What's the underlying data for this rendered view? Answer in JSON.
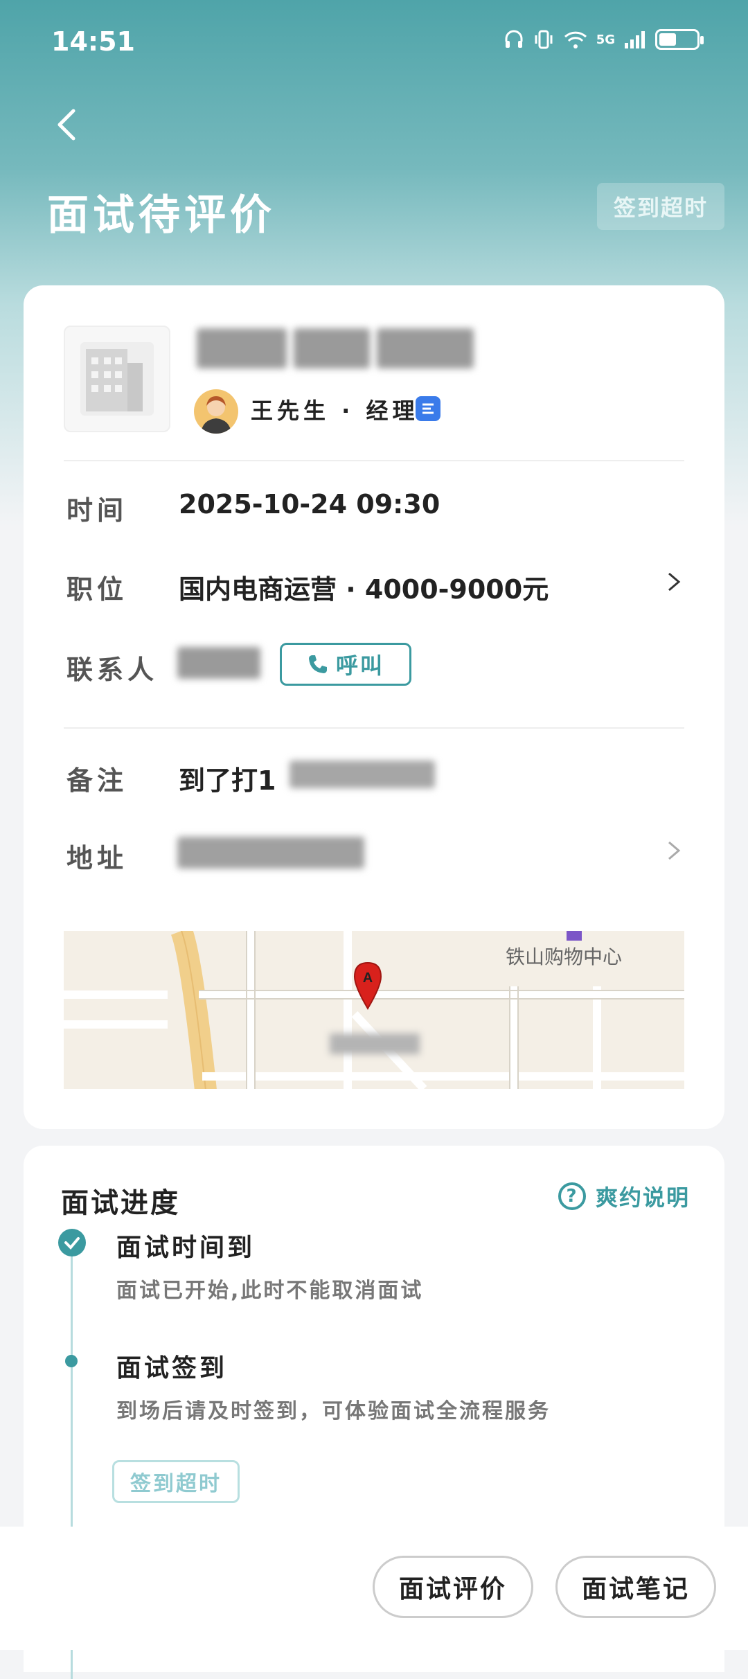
{
  "status_bar": {
    "time": "14:51",
    "network": "5G"
  },
  "header": {
    "title": "面试待评价",
    "status_badge": "签到超时"
  },
  "company": {
    "name": "",
    "contact_person": "王先生 · 经理"
  },
  "details": {
    "time_label": "时间",
    "time_value": "2025-10-24 09:30",
    "position_label": "职位",
    "position_value": "国内电商运营 · 4000-9000元",
    "contact_label": "联系人",
    "call_button": "呼叫",
    "note_label": "备注",
    "note_value": "到了打1",
    "address_label": "地址"
  },
  "map": {
    "poi_label": "铁山购物中心",
    "marker_letter": "A"
  },
  "progress": {
    "title": "面试进度",
    "help_label": "爽约说明",
    "steps": [
      {
        "title": "面试时间到",
        "desc": "面试已开始,此时不能取消面试"
      },
      {
        "title": "面试签到",
        "desc": "到场后请及时签到，可体验面试全流程服务",
        "badge": "签到超时"
      }
    ]
  },
  "bottom_actions": {
    "review_button": "面试评价",
    "notes_button": "面试笔记"
  },
  "colors": {
    "accent": "#3b9aa0",
    "verify_blue": "#3a7bea"
  }
}
